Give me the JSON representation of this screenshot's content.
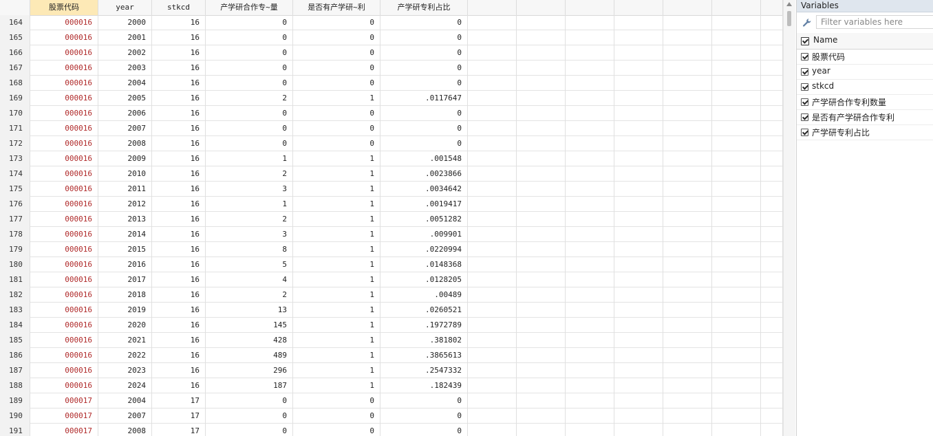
{
  "grid": {
    "columns": [
      "股票代码",
      "year",
      "stkcd",
      "产学研合作专~量",
      "是否有产学研~利",
      "产学研专利占比"
    ],
    "rows": [
      [
        "164",
        "000016",
        "2000",
        "16",
        "0",
        "0",
        "0"
      ],
      [
        "165",
        "000016",
        "2001",
        "16",
        "0",
        "0",
        "0"
      ],
      [
        "166",
        "000016",
        "2002",
        "16",
        "0",
        "0",
        "0"
      ],
      [
        "167",
        "000016",
        "2003",
        "16",
        "0",
        "0",
        "0"
      ],
      [
        "168",
        "000016",
        "2004",
        "16",
        "0",
        "0",
        "0"
      ],
      [
        "169",
        "000016",
        "2005",
        "16",
        "2",
        "1",
        ".0117647"
      ],
      [
        "170",
        "000016",
        "2006",
        "16",
        "0",
        "0",
        "0"
      ],
      [
        "171",
        "000016",
        "2007",
        "16",
        "0",
        "0",
        "0"
      ],
      [
        "172",
        "000016",
        "2008",
        "16",
        "0",
        "0",
        "0"
      ],
      [
        "173",
        "000016",
        "2009",
        "16",
        "1",
        "1",
        ".001548"
      ],
      [
        "174",
        "000016",
        "2010",
        "16",
        "2",
        "1",
        ".0023866"
      ],
      [
        "175",
        "000016",
        "2011",
        "16",
        "3",
        "1",
        ".0034642"
      ],
      [
        "176",
        "000016",
        "2012",
        "16",
        "1",
        "1",
        ".0019417"
      ],
      [
        "177",
        "000016",
        "2013",
        "16",
        "2",
        "1",
        ".0051282"
      ],
      [
        "178",
        "000016",
        "2014",
        "16",
        "3",
        "1",
        ".009901"
      ],
      [
        "179",
        "000016",
        "2015",
        "16",
        "8",
        "1",
        ".0220994"
      ],
      [
        "180",
        "000016",
        "2016",
        "16",
        "5",
        "1",
        ".0148368"
      ],
      [
        "181",
        "000016",
        "2017",
        "16",
        "4",
        "1",
        ".0128205"
      ],
      [
        "182",
        "000016",
        "2018",
        "16",
        "2",
        "1",
        ".00489"
      ],
      [
        "183",
        "000016",
        "2019",
        "16",
        "13",
        "1",
        ".0260521"
      ],
      [
        "184",
        "000016",
        "2020",
        "16",
        "145",
        "1",
        ".1972789"
      ],
      [
        "185",
        "000016",
        "2021",
        "16",
        "428",
        "1",
        ".381802"
      ],
      [
        "186",
        "000016",
        "2022",
        "16",
        "489",
        "1",
        ".3865613"
      ],
      [
        "187",
        "000016",
        "2023",
        "16",
        "296",
        "1",
        ".2547332"
      ],
      [
        "188",
        "000016",
        "2024",
        "16",
        "187",
        "1",
        ".182439"
      ],
      [
        "189",
        "000017",
        "2004",
        "17",
        "0",
        "0",
        "0"
      ],
      [
        "190",
        "000017",
        "2007",
        "17",
        "0",
        "0",
        "0"
      ],
      [
        "191",
        "000017",
        "2008",
        "17",
        "0",
        "0",
        "0"
      ]
    ],
    "string_color": "#b02a2a",
    "selected_header_color": "#fde9b6"
  },
  "variables_panel": {
    "title": "Variables",
    "filter_placeholder": "Filter variables here",
    "name_header": "Name",
    "items": [
      "股票代码",
      "year",
      "stkcd",
      "产学研合作专利数量",
      "是否有产学研合作专利",
      "产学研专利占比"
    ]
  }
}
